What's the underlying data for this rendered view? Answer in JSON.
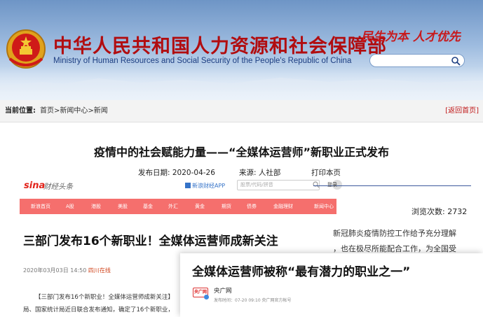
{
  "header": {
    "title_cn": "中华人民共和国人力资源和社会保障部",
    "title_en": "Ministry of Human Resources and Social Security of the People's Republic of China",
    "slogan": "民生为本 人才优先",
    "search": {
      "value": "",
      "placeholder": ""
    }
  },
  "breadcrumb": {
    "label": "当前位置:",
    "path": "首页>新闻中心>新闻",
    "back": "[返回首页]"
  },
  "article": {
    "title": "疫情中的社会赋能力量——“全媒体运营师”新职业正式发布",
    "publish_date": "发布日期: 2020-04-26",
    "source": "来源: 人社部",
    "print": "打印本页",
    "views": "浏览次数:  2732"
  },
  "embedded": {
    "sina_logo_main": "sina",
    "sina_logo_sub": "财经头条",
    "app_link": "新浪财经APP",
    "search_placeholder": "股票/代码/拼音",
    "user_text": "登录",
    "nav_items": [
      "新浪首页",
      "A股",
      "港股",
      "美股",
      "基金",
      "外汇",
      "黄金",
      "期货",
      "债券",
      "金融理财",
      "新闻中心"
    ],
    "headline": "三部门发布16个新职业！全媒体运营师成新关注",
    "date": "2020年03月03日 14:50",
    "date_source": "四川在线",
    "body_lines": [
      "【三部门发布16个新职业！全媒体运营师成新关注】",
      "局、国家统计局近日联合发布通知，确定了16个新职业，"
    ],
    "side_lines": [
      "新冠肺炎疫情防控工作给予充分理解",
      "，也在极尽所能配合工作，为全国受"
    ]
  },
  "overlay": {
    "title": "全媒体运营师被称“最有潜力的职业之一”",
    "logo_text": "央广网",
    "account": "央广网",
    "meta": "发布时间：07-20 09:10   央广网官方帐号"
  },
  "colors": {
    "title_red": "#b10d10",
    "english_blue": "#1e3f82",
    "nav_red": "#f56f6d",
    "back_link": "#c01919"
  }
}
